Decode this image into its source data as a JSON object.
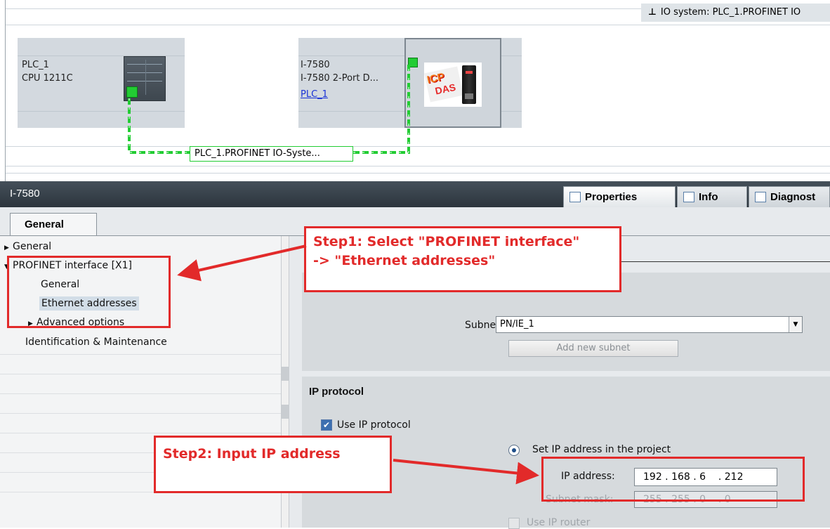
{
  "network_view": {
    "io_system_label": "IO system: PLC_1.PROFINET IO",
    "plc": {
      "name": "PLC_1",
      "type": "CPU 1211C"
    },
    "io_device": {
      "name": "I-7580",
      "type": "I-7580 2-Port D...",
      "controller_link": "PLC_1",
      "logo_text": "ICP DAS"
    },
    "profinet_line_label": "PLC_1.PROFINET IO-Syste..."
  },
  "inspector": {
    "title": "I-7580",
    "tabs": [
      "Properties",
      "Info",
      "Diagnost"
    ],
    "general_tab": "General",
    "tree": [
      {
        "label": "General",
        "level": 0,
        "arrow": "right"
      },
      {
        "label": "PROFINET interface [X1]",
        "level": 0,
        "arrow": "down"
      },
      {
        "label": "General",
        "level": 1,
        "arrow": ""
      },
      {
        "label": "Ethernet addresses",
        "level": 1,
        "arrow": "",
        "selected": true
      },
      {
        "label": "Advanced options",
        "level": 1,
        "arrow": "right"
      },
      {
        "label": "Identification & Maintenance",
        "level": 0,
        "arrow": ""
      }
    ],
    "subnet_label": "Subnet:",
    "subnet_value": "PN/IE_1",
    "add_subnet_button": "Add new subnet",
    "ip_protocol_heading": "IP protocol",
    "use_ip_protocol": "Use IP protocol",
    "set_ip_in_project": "Set IP address in the project",
    "ip_address_label": "IP address:",
    "ip_address_value": "192 . 168 . 6    . 212",
    "subnet_mask_label": "Subnet mask:",
    "subnet_mask_value": "255 . 255 . 0    . 0",
    "use_ip_router": "Use IP router"
  },
  "callouts": {
    "step1": "Step1: Select \"PROFINET interface\"\n-> \"Ethernet addresses\"",
    "step2": "Step2: Input IP address"
  },
  "colors": {
    "accent_red": "#e22a2a",
    "profinet_green": "#22cc33",
    "title_bar": "#38424b"
  }
}
